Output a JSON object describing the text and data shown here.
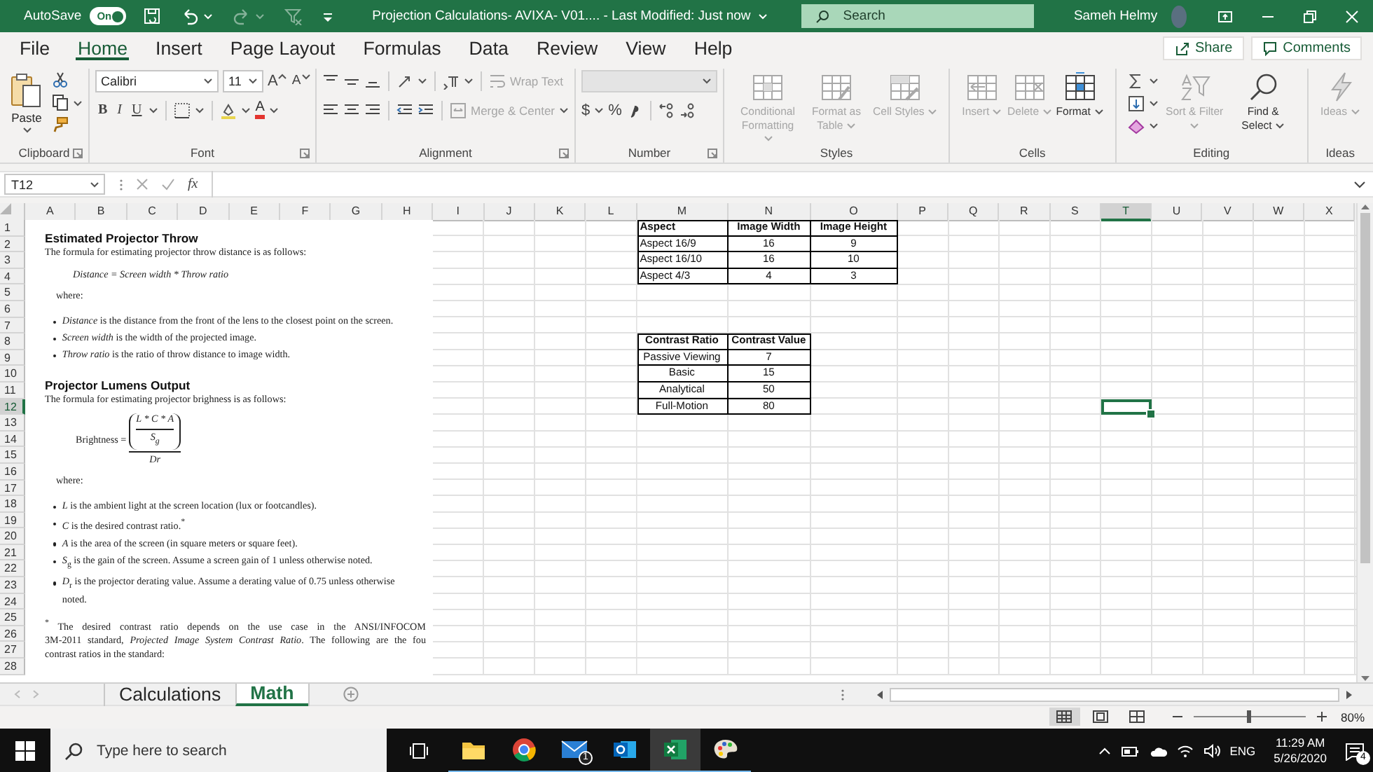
{
  "title_bar": {
    "autosave_label": "AutoSave",
    "autosave": {
      "on": true,
      "label": "On"
    },
    "title": "Projection Calculations- AVIXA- V01....  - Last Modified: Just now",
    "search_placeholder": "Search",
    "user_name": "Sameh Helmy"
  },
  "menu_tabs": [
    {
      "label": "File",
      "selected": false
    },
    {
      "label": "Home",
      "selected": true
    },
    {
      "label": "Insert",
      "selected": false
    },
    {
      "label": "Page Layout",
      "selected": false
    },
    {
      "label": "Formulas",
      "selected": false
    },
    {
      "label": "Data",
      "selected": false
    },
    {
      "label": "Review",
      "selected": false
    },
    {
      "label": "View",
      "selected": false
    },
    {
      "label": "Help",
      "selected": false
    }
  ],
  "share_button": "Share",
  "comments_button": "Comments",
  "ribbon": {
    "groups": [
      {
        "kind": "clipboard",
        "label": "Clipboard",
        "paste": "Paste"
      },
      {
        "kind": "font",
        "label": "Font",
        "family": "Calibri",
        "size": "11",
        "grow": "A",
        "shrink": "A",
        "bold": "B",
        "italic": "I",
        "underline": "U",
        "font_color": "A"
      },
      {
        "kind": "alignment",
        "label": "Alignment",
        "wrap_text": {
          "label": "Wrap Text",
          "disabled": true
        },
        "merge": {
          "label": "Merge & Center",
          "disabled": true
        }
      },
      {
        "kind": "number",
        "label": "Number",
        "currency": "$",
        "percent": "%"
      },
      {
        "kind": "large",
        "label": "Styles",
        "items": [
          {
            "kind": "conditional",
            "label": "Conditional Formatting",
            "disabled": true
          },
          {
            "kind": "table",
            "label": "Format as Table",
            "disabled": true
          },
          {
            "kind": "cell_styles",
            "label": "Cell Styles",
            "disabled": true
          }
        ]
      },
      {
        "kind": "large",
        "label": "Cells",
        "items": [
          {
            "kind": "insert",
            "label": "Insert",
            "disabled": true
          },
          {
            "kind": "delete",
            "label": "Delete",
            "disabled": true
          },
          {
            "kind": "format",
            "label": "Format",
            "disabled": false
          }
        ]
      },
      {
        "kind": "editing",
        "label": "Editing",
        "items": [
          {
            "kind": "sort",
            "label": "Sort & Filter",
            "disabled": true
          },
          {
            "kind": "find",
            "label": "Find & Select",
            "disabled": false
          }
        ]
      },
      {
        "kind": "large",
        "label": "Ideas",
        "items": [
          {
            "kind": "bolt",
            "label": "Ideas",
            "disabled": true
          }
        ]
      }
    ]
  },
  "formula_bar": {
    "name_box": "T12",
    "function_label": "fx"
  },
  "sheet": {
    "columns": [
      {
        "label": "A",
        "selected": false
      },
      {
        "label": "B",
        "selected": false
      },
      {
        "label": "C",
        "selected": false
      },
      {
        "label": "D",
        "selected": false
      },
      {
        "label": "E",
        "selected": false
      },
      {
        "label": "F",
        "selected": false
      },
      {
        "label": "G",
        "selected": false
      },
      {
        "label": "H",
        "selected": false
      },
      {
        "label": "I",
        "selected": false
      },
      {
        "label": "J",
        "selected": false
      },
      {
        "label": "K",
        "selected": false
      },
      {
        "label": "L",
        "selected": false
      },
      {
        "label": "M",
        "selected": false
      },
      {
        "label": "N",
        "selected": false
      },
      {
        "label": "O",
        "selected": false
      },
      {
        "label": "P",
        "selected": false
      },
      {
        "label": "Q",
        "selected": false
      },
      {
        "label": "R",
        "selected": false
      },
      {
        "label": "S",
        "selected": false
      },
      {
        "label": "T",
        "selected": true
      },
      {
        "label": "U",
        "selected": false
      },
      {
        "label": "V",
        "selected": false
      },
      {
        "label": "W",
        "selected": false
      },
      {
        "label": "X",
        "selected": false
      }
    ],
    "rows": [
      {
        "label": "1",
        "selected": false
      },
      {
        "label": "2",
        "selected": false
      },
      {
        "label": "3",
        "selected": false
      },
      {
        "label": "4",
        "selected": false
      },
      {
        "label": "5",
        "selected": false
      },
      {
        "label": "6",
        "selected": false
      },
      {
        "label": "7",
        "selected": false
      },
      {
        "label": "8",
        "selected": false
      },
      {
        "label": "9",
        "selected": false
      },
      {
        "label": "10",
        "selected": false
      },
      {
        "label": "11",
        "selected": false
      },
      {
        "label": "12",
        "selected": true
      },
      {
        "label": "13",
        "selected": false
      },
      {
        "label": "14",
        "selected": false
      },
      {
        "label": "15",
        "selected": false
      },
      {
        "label": "16",
        "selected": false
      },
      {
        "label": "17",
        "selected": false
      },
      {
        "label": "18",
        "selected": false
      },
      {
        "label": "19",
        "selected": false
      },
      {
        "label": "20",
        "selected": false
      },
      {
        "label": "21",
        "selected": false
      },
      {
        "label": "22",
        "selected": false
      },
      {
        "label": "23",
        "selected": false
      },
      {
        "label": "24",
        "selected": false
      },
      {
        "label": "25",
        "selected": false
      },
      {
        "label": "26",
        "selected": false
      },
      {
        "label": "27",
        "selected": false
      },
      {
        "label": "28",
        "selected": false
      }
    ],
    "tables": [
      {
        "first_column_centered": false,
        "header": [
          "Aspect",
          "Image Width",
          "Image Height"
        ],
        "rows": [
          [
            "Aspect 16/9",
            "16",
            "9"
          ],
          [
            "Aspect 16/10",
            "16",
            "10"
          ],
          [
            "Aspect 4/3",
            "4",
            "3"
          ]
        ]
      },
      {
        "first_column_centered": true,
        "header": [
          "Contrast Ratio",
          "Contrast Value"
        ],
        "rows": [
          [
            "Passive Viewing",
            "7"
          ],
          [
            "Basic",
            "15"
          ],
          [
            "Analytical",
            "50"
          ],
          [
            "Full-Motion",
            "80"
          ]
        ]
      }
    ]
  },
  "document": {
    "sections": [
      {
        "heading": "Estimated Projector Throw",
        "intro": "The formula for estimating projector throw distance is as follows:",
        "formula": {
          "kind": "inline",
          "text": "Distance = Screen width * Throw ratio"
        },
        "where": "where:",
        "bullets": [
          "*Distance* is the distance from the front of the lens to the closest point on the screen.",
          "*Screen width* is the width of the projected image.",
          "*Throw ratio* is the ratio of throw distance to image width."
        ]
      },
      {
        "heading": "Projector Lumens Output",
        "intro": "The formula for estimating projector brighness is as follows:",
        "formula": {
          "kind": "fraction",
          "lhs": "Brightness =",
          "numerator": "L * C * A",
          "inner_denominator": "S$_{g}$",
          "denominator": "Dr"
        },
        "where": "where:",
        "bullets": [
          "*L* is the ambient light at the screen location (lux or footcandles).",
          "*C* is the desired contrast ratio.$^{*}$",
          "*A* is the area of the screen (in square meters or square feet).",
          "*S*$_{g}$ is the gain of the screen. Assume a screen gain of 1 unless otherwise noted.",
          "*D*$_{r}$ is the projector derating value. Assume a derating value of 0.75 unless otherwise noted."
        ]
      }
    ],
    "footnote_lines": [
      "$^{*}$ The desired contrast ratio depends on the use case in the ANSI/INFOCOM",
      "3M-2011 standard, *Projected Image System Contrast Ratio*. The following are the fou",
      "contrast ratios in the standard:"
    ]
  },
  "sheet_tabs": [
    {
      "label": "Calculations",
      "selected": false
    },
    {
      "label": "Math",
      "selected": true
    }
  ],
  "status_bar": {
    "views": [
      {
        "kind": "normal",
        "selected": true
      },
      {
        "kind": "page_layout",
        "selected": false
      },
      {
        "kind": "page_break",
        "selected": false
      }
    ],
    "zoom": {
      "level": 0.5,
      "reading": "80%"
    }
  },
  "taskbar": {
    "search_placeholder": "Type here to search",
    "apps": [
      {
        "kind": "explorer",
        "selected": false
      },
      {
        "kind": "chrome",
        "selected": false
      },
      {
        "kind": "mail",
        "selected": false,
        "badge": "1"
      },
      {
        "kind": "outlook",
        "selected": false
      },
      {
        "kind": "excel",
        "selected": true
      },
      {
        "kind": "paint",
        "selected": false
      }
    ],
    "language": "ENG",
    "time": "11:29 AM",
    "date": "5/26/2020",
    "notifications": "4"
  }
}
